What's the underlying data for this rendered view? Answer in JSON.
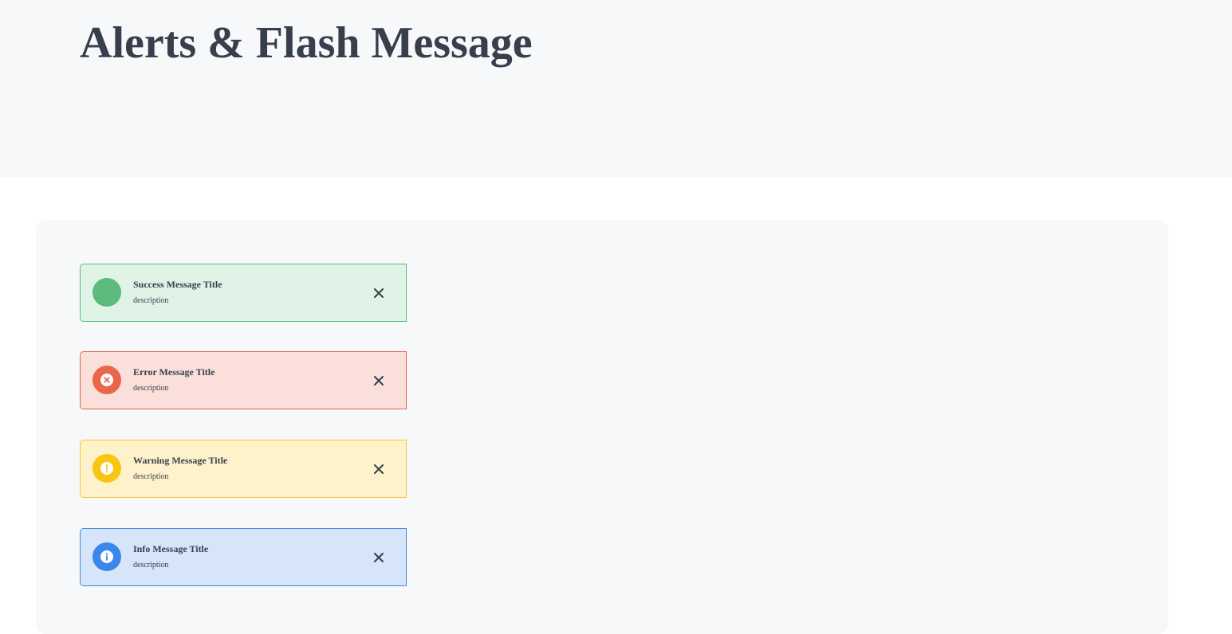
{
  "page": {
    "title": "Alerts & Flash Message"
  },
  "alerts": [
    {
      "type": "success",
      "title": "Success Message Title",
      "description": "description",
      "icon": "success-icon",
      "color": "#5abb7d"
    },
    {
      "type": "error",
      "title": "Error Message Title",
      "description": "description",
      "icon": "error-x-icon",
      "color": "#ea6549"
    },
    {
      "type": "warning",
      "title": "Warning Message Title",
      "description": "description",
      "icon": "warning-exclamation-icon",
      "color": "#f8c512"
    },
    {
      "type": "info",
      "title": "Info Message Title",
      "description": "description",
      "icon": "info-icon",
      "color": "#3a87ea"
    }
  ],
  "close_icon": "close-icon"
}
